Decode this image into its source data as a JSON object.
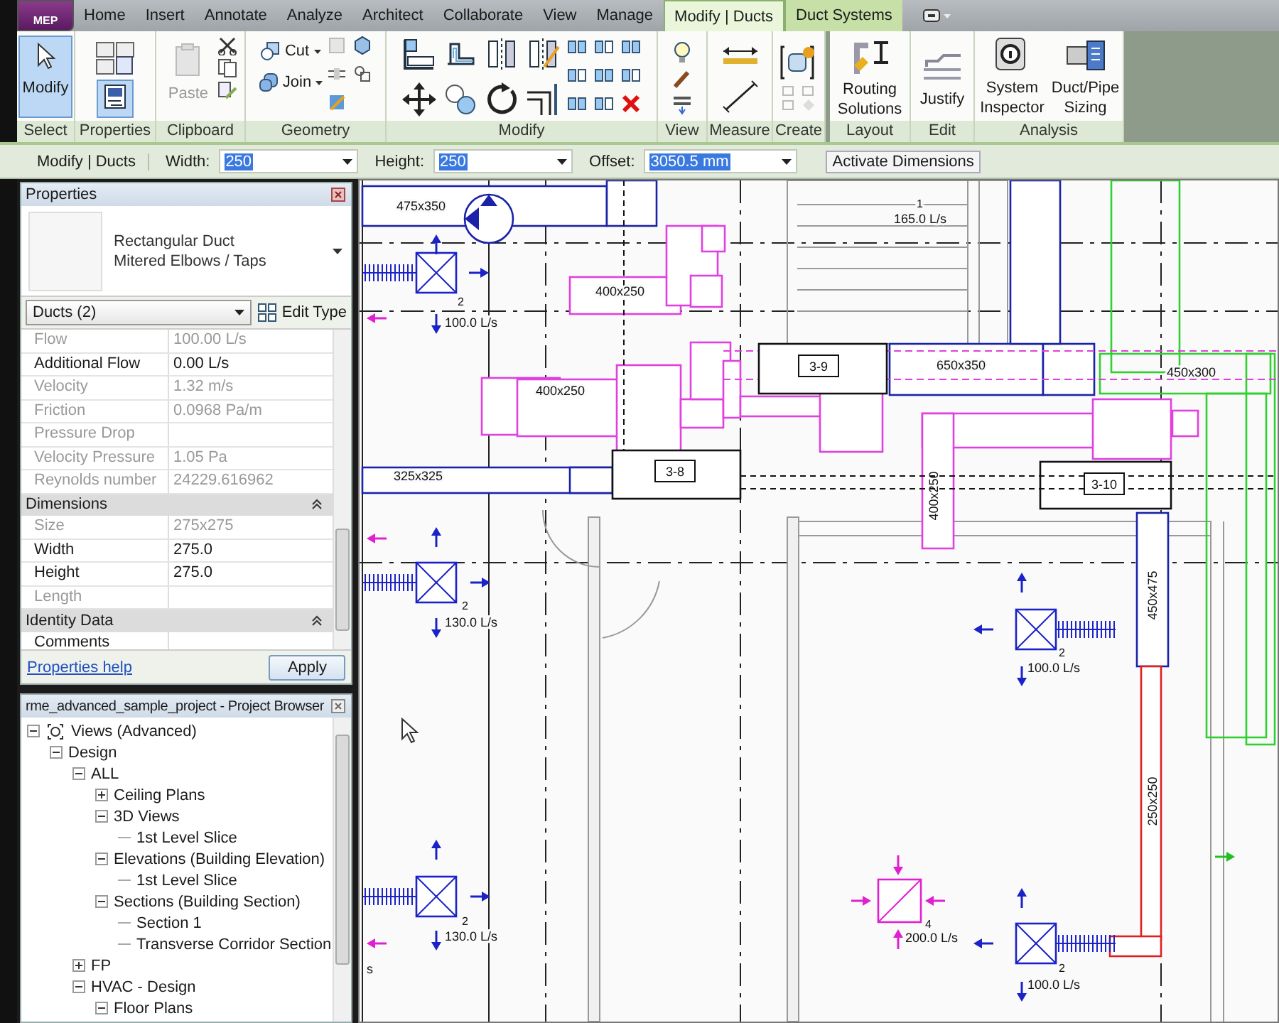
{
  "app_button": {
    "label": "MEP"
  },
  "ribbon_tabs": [
    {
      "label": "Home",
      "selected": false,
      "kind": "normal"
    },
    {
      "label": "Insert",
      "selected": false,
      "kind": "normal"
    },
    {
      "label": "Annotate",
      "selected": false,
      "kind": "normal"
    },
    {
      "label": "Analyze",
      "selected": false,
      "kind": "normal"
    },
    {
      "label": "Architect",
      "selected": false,
      "kind": "normal"
    },
    {
      "label": "Collaborate",
      "selected": false,
      "kind": "normal"
    },
    {
      "label": "View",
      "selected": false,
      "kind": "normal"
    },
    {
      "label": "Manage",
      "selected": false,
      "kind": "normal"
    },
    {
      "label": "Modify | Ducts",
      "selected": true,
      "kind": "contextual"
    },
    {
      "label": "Duct Systems",
      "selected": false,
      "kind": "contextual"
    }
  ],
  "ribbon_panels": [
    {
      "title": "Select",
      "tools": [
        {
          "label": "Modify",
          "selected": true
        }
      ]
    },
    {
      "title": "Properties",
      "tools": [
        {
          "selected": true
        }
      ]
    },
    {
      "title": "Clipboard",
      "tools": [
        {
          "label": "Paste",
          "disabled": true
        }
      ]
    },
    {
      "title": "Geometry",
      "tools": [
        {
          "label": "Cut"
        },
        {
          "label": "Join"
        }
      ]
    },
    {
      "title": "Modify"
    },
    {
      "title": "View"
    },
    {
      "title": "Measure"
    },
    {
      "title": "Create"
    },
    {
      "title": "Layout",
      "tools": [
        {
          "label": "Routing Solutions"
        }
      ]
    },
    {
      "title": "Edit",
      "tools": [
        {
          "label": "Justify"
        }
      ]
    },
    {
      "title": "Analysis",
      "tools": [
        {
          "label": "System Inspector"
        },
        {
          "label": "Duct/Pipe Sizing"
        }
      ]
    }
  ],
  "options_bar": {
    "context": "Modify | Ducts",
    "fields": [
      {
        "label": "Width:",
        "value": "250"
      },
      {
        "label": "Height:",
        "value": "250"
      },
      {
        "label": "Offset:",
        "value": "3050.5 mm"
      }
    ],
    "button": "Activate Dimensions"
  },
  "properties": {
    "title": "Properties",
    "type_lines": [
      "Rectangular Duct",
      "Mitered Elbows / Taps"
    ],
    "selector": "Ducts (2)",
    "edit_type": "Edit Type",
    "rows": [
      {
        "kind": "param",
        "name": "Flow",
        "value": "100.00 L/s",
        "disabled": true
      },
      {
        "kind": "param",
        "name": "Additional Flow",
        "value": "0.00 L/s",
        "disabled": false
      },
      {
        "kind": "param",
        "name": "Velocity",
        "value": "1.32 m/s",
        "disabled": true
      },
      {
        "kind": "param",
        "name": "Friction",
        "value": "0.0968 Pa/m",
        "disabled": true
      },
      {
        "kind": "param",
        "name": "Pressure Drop",
        "disabled": true
      },
      {
        "kind": "param",
        "name": "Velocity Pressure",
        "value": "1.05 Pa",
        "disabled": true
      },
      {
        "kind": "param",
        "name": "Reynolds number",
        "value": "24229.616962",
        "disabled": true
      },
      {
        "kind": "group",
        "name": "Dimensions"
      },
      {
        "kind": "param",
        "name": "Size",
        "value": "275x275",
        "disabled": true
      },
      {
        "kind": "param",
        "name": "Width",
        "value": "275.0",
        "disabled": false
      },
      {
        "kind": "param",
        "name": "Height",
        "value": "275.0",
        "disabled": false
      },
      {
        "kind": "param",
        "name": "Length",
        "disabled": true
      },
      {
        "kind": "group",
        "name": "Identity Data"
      },
      {
        "kind": "param",
        "name": "Comments",
        "disabled": false
      }
    ],
    "help": "Properties help",
    "apply": "Apply"
  },
  "project_browser": {
    "title": "rme_advanced_sample_project - Project Browser",
    "tree": [
      {
        "label": "Views (Advanced)",
        "expanded": true,
        "children": [
          {
            "label": "Design",
            "expanded": true,
            "children": [
              {
                "label": "ALL",
                "expanded": true,
                "children": [
                  {
                    "label": "Ceiling Plans",
                    "expanded": false
                  },
                  {
                    "label": "3D Views",
                    "expanded": true,
                    "children": [
                      {
                        "label": "1st Level Slice"
                      }
                    ]
                  },
                  {
                    "label": "Elevations (Building Elevation)",
                    "expanded": true,
                    "children": [
                      {
                        "label": "1st Level Slice"
                      }
                    ]
                  },
                  {
                    "label": "Sections (Building Section)",
                    "expanded": true,
                    "children": [
                      {
                        "label": "Section 1"
                      },
                      {
                        "label": "Transverse Corridor Section"
                      }
                    ]
                  }
                ]
              },
              {
                "label": "FP",
                "expanded": false
              },
              {
                "label": "HVAC - Design",
                "expanded": true,
                "children": [
                  {
                    "label": "Floor Plans",
                    "expanded": true
                  }
                ]
              }
            ]
          }
        ]
      }
    ]
  },
  "canvas": {
    "labels": [
      {
        "text": "475x350",
        "kind": "size"
      },
      {
        "text": "1",
        "kind": "count"
      },
      {
        "text": "165.0 L/s",
        "kind": "flow"
      },
      {
        "text": "400x250",
        "kind": "size"
      },
      {
        "text": "2",
        "kind": "count"
      },
      {
        "text": "100.0 L/s",
        "kind": "flow"
      },
      {
        "text": "3-9",
        "kind": "tag"
      },
      {
        "text": "650x350",
        "kind": "size"
      },
      {
        "text": "400x250",
        "kind": "size"
      },
      {
        "text": "450x300",
        "kind": "size"
      },
      {
        "text": "325x325",
        "kind": "size"
      },
      {
        "text": "3-8",
        "kind": "tag"
      },
      {
        "text": "400x250",
        "kind": "size_vertical"
      },
      {
        "text": "3-10",
        "kind": "tag"
      },
      {
        "text": "450x475",
        "kind": "size_vertical"
      },
      {
        "text": "2",
        "kind": "count"
      },
      {
        "text": "130.0 L/s",
        "kind": "flow"
      },
      {
        "text": "2",
        "kind": "count"
      },
      {
        "text": "100.0 L/s",
        "kind": "flow"
      },
      {
        "text": "250x250",
        "kind": "size_vertical"
      },
      {
        "text": "2",
        "kind": "count"
      },
      {
        "text": "4",
        "kind": "count"
      },
      {
        "text": "130.0 L/s",
        "kind": "flow"
      },
      {
        "text": "200.0 L/s",
        "kind": "flow"
      },
      {
        "text": "s",
        "kind": "flow"
      },
      {
        "text": "2",
        "kind": "count"
      },
      {
        "text": "100.0 L/s",
        "kind": "flow"
      }
    ]
  }
}
